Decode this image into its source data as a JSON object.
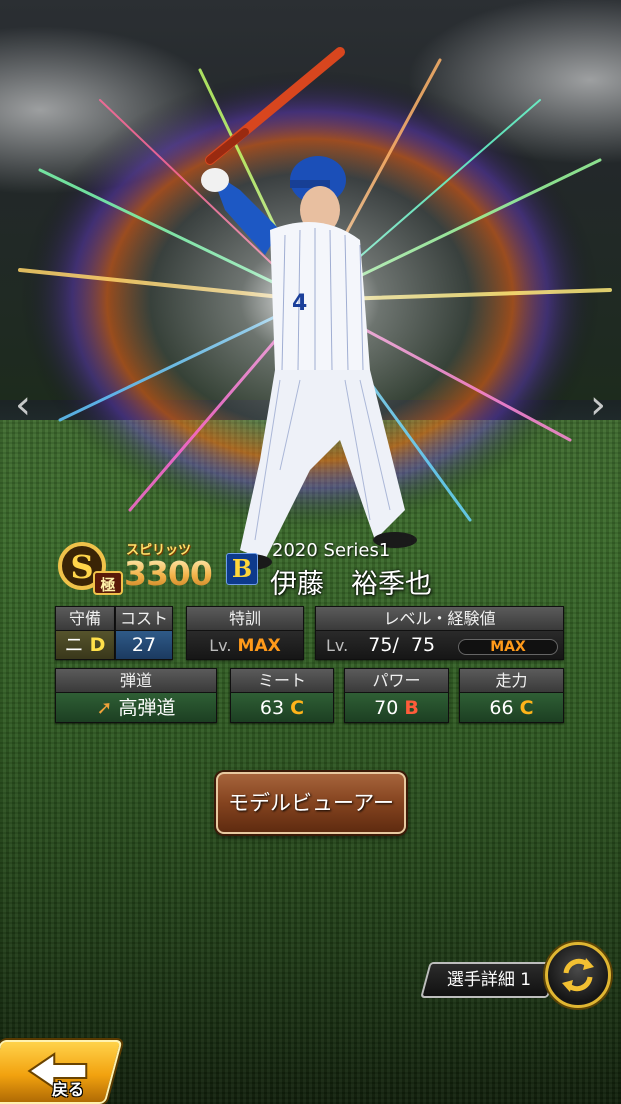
{
  "player": {
    "spirits_label": "スピリッツ",
    "spirits_value": "3300",
    "rank_letter": "S",
    "rank_sub": "極",
    "team_logo": "B",
    "series": "2020 Series1",
    "name": "伊藤　裕季也",
    "uniform_number": "4"
  },
  "stats": {
    "position": {
      "header": "守備",
      "value": "ニ",
      "grade": "D"
    },
    "cost": {
      "header": "コスト",
      "value": "27"
    },
    "training": {
      "header": "特訓",
      "lv_prefix": "Lv.",
      "value": "MAX"
    },
    "level": {
      "header": "レベル・経験値",
      "lv_prefix": "Lv.",
      "current": "75",
      "separator": "/",
      "max": "75",
      "exp_label": "MAX"
    },
    "trajectory": {
      "header": "弾道",
      "value": "高弾道",
      "icon": "arrow-up-right-icon"
    },
    "meet": {
      "header": "ミート",
      "value": "63",
      "grade": "C"
    },
    "power": {
      "header": "パワー",
      "value": "70",
      "grade": "B"
    },
    "speed": {
      "header": "走力",
      "value": "66",
      "grade": "C"
    }
  },
  "buttons": {
    "model_viewer": "モデルビューアー",
    "player_detail": "選手詳細 1",
    "back": "戻る",
    "prev_arrow": "‹",
    "next_arrow": "›"
  },
  "colors": {
    "grade_c": "#ffb41a",
    "grade_b": "#ff5c3a",
    "grade_d": "#ffe04a",
    "max": "#ff9a1a",
    "team_blue": "#0d3a8c",
    "gold": "#f2a20f"
  }
}
